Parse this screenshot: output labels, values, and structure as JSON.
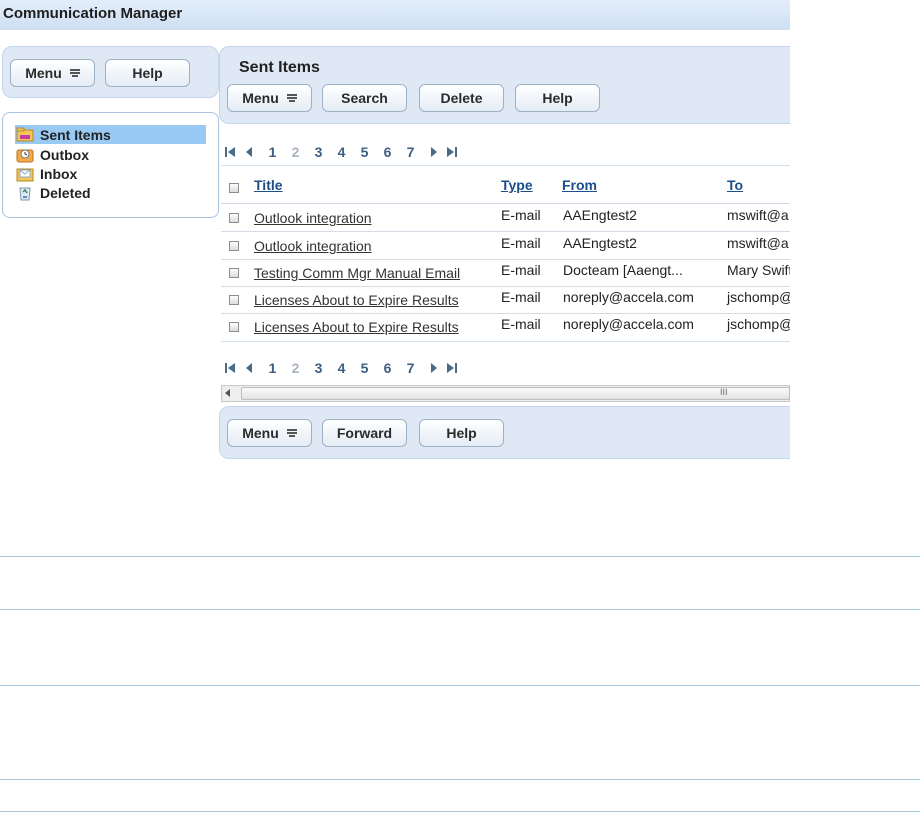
{
  "app": {
    "title": "Communication Manager"
  },
  "left_toolbar": {
    "menu_label": "Menu",
    "help_label": "Help"
  },
  "folders": [
    {
      "label": "Sent Items",
      "icon": "sent-items-icon",
      "selected": true
    },
    {
      "label": "Outbox",
      "icon": "outbox-icon",
      "selected": false
    },
    {
      "label": "Inbox",
      "icon": "inbox-icon",
      "selected": false
    },
    {
      "label": "Deleted",
      "icon": "recycle-icon",
      "selected": false
    }
  ],
  "main": {
    "heading": "Sent Items",
    "toolbar": {
      "menu_label": "Menu",
      "search_label": "Search",
      "delete_label": "Delete",
      "help_label": "Help"
    }
  },
  "pager": {
    "pages": [
      "1",
      "2",
      "3",
      "4",
      "5",
      "6",
      "7"
    ],
    "current": "2"
  },
  "grid": {
    "columns": [
      "Title",
      "Type",
      "From",
      "To"
    ],
    "rows": [
      {
        "title": "Outlook integration",
        "type": "E-mail",
        "from": "AAEngtest2",
        "to": "mswift@a"
      },
      {
        "title": "Outlook integration",
        "type": "E-mail",
        "from": "AAEngtest2",
        "to": "mswift@a"
      },
      {
        "title": "Testing Comm Mgr Manual Email",
        "type": "E-mail",
        "from": "Docteam [Aaengt...",
        "to": "Mary Swift"
      },
      {
        "title": "Licenses About to Expire Results",
        "type": "E-mail",
        "from": "noreply@accela.com",
        "to": "jschomp@"
      },
      {
        "title": "Licenses About to Expire Results",
        "type": "E-mail",
        "from": "noreply@accela.com",
        "to": "jschomp@"
      }
    ]
  },
  "scrollbar": {
    "grip": "III"
  },
  "bottom_toolbar": {
    "menu_label": "Menu",
    "forward_label": "Forward",
    "help_label": "Help"
  }
}
